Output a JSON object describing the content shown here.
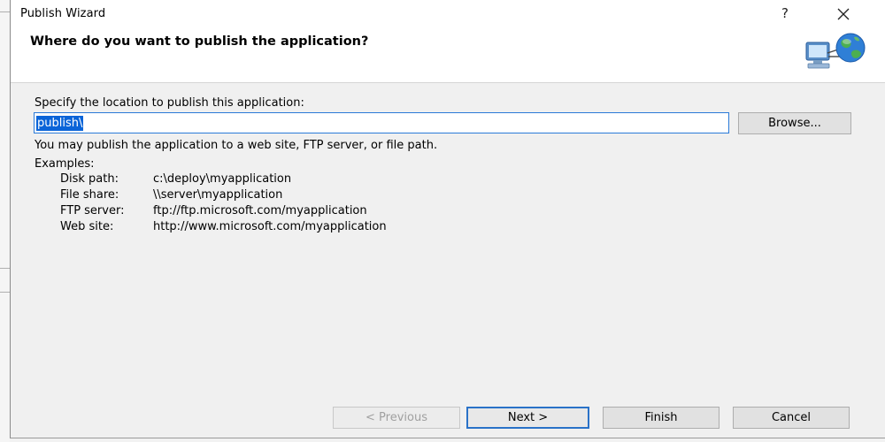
{
  "window": {
    "title": "Publish Wizard",
    "help_label": "?",
    "close_icon": "close-icon"
  },
  "header": {
    "heading": "Where do you want to publish the application?",
    "icon": "publish-globe-computer-icon"
  },
  "location": {
    "prompt": "Specify the location to publish this application:",
    "value": "publish\\",
    "browse_label": "Browse..."
  },
  "info": {
    "description": "You may publish the application to a web site, FTP server, or file path.",
    "examples_label": "Examples:",
    "examples": [
      {
        "label": "Disk path:",
        "value": "c:\\deploy\\myapplication"
      },
      {
        "label": "File share:",
        "value": "\\\\server\\myapplication"
      },
      {
        "label": "FTP server:",
        "value": "ftp://ftp.microsoft.com/myapplication"
      },
      {
        "label": "Web site:",
        "value": "http://www.microsoft.com/myapplication"
      }
    ]
  },
  "footer": {
    "previous_label": "< Previous",
    "next_label": "Next >",
    "finish_label": "Finish",
    "cancel_label": "Cancel"
  },
  "colors": {
    "accent": "#0a64d8",
    "dialog_bg": "#f0f0f0",
    "header_bg": "#ffffff"
  }
}
